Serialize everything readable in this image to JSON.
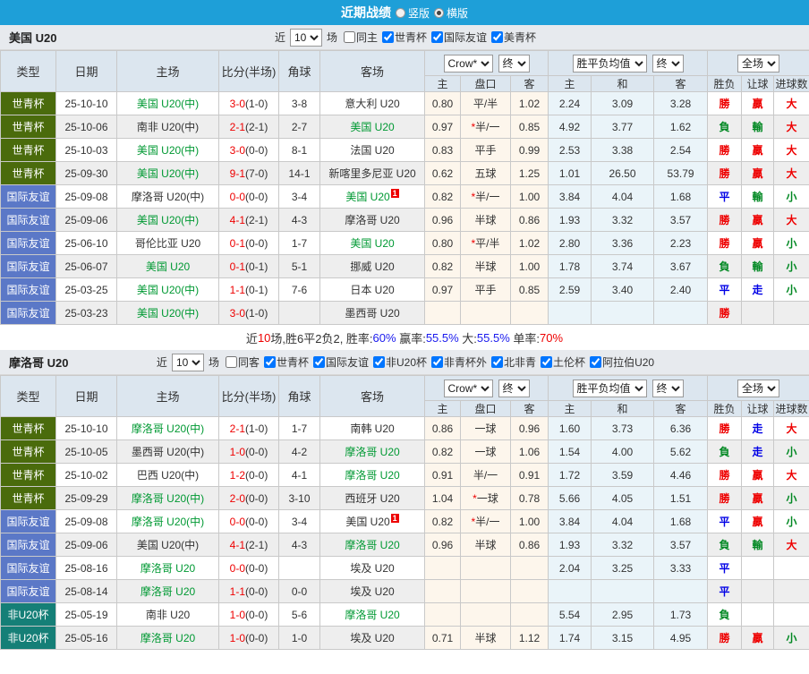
{
  "topbar": {
    "title": "近期战绩",
    "vertical_label": "竖版",
    "horizontal_label": "横版",
    "selected": "横版"
  },
  "filter": {
    "near": "近",
    "count": "10",
    "games": "场"
  },
  "table_header": {
    "type": "类型",
    "date": "日期",
    "home": "主场",
    "score": "比分(半场)",
    "corner": "角球",
    "away": "客场",
    "crow": "Crow*",
    "final": "终",
    "avg": "胜平负均值",
    "scope": "全场",
    "sub": [
      "主",
      "盘口",
      "客",
      "主",
      "和",
      "客",
      "胜负",
      "让球",
      "进球数"
    ]
  },
  "colors": {
    "type": {
      "世青杯": "#4a6b0c",
      "国际友谊": "#5b78c7",
      "非U20杯": "#157f77"
    },
    "focus_team": "#009933",
    "win": "#ee0000",
    "lose": "#008822",
    "draw": "#0000e6",
    "topbar": "#1e9fd8",
    "header_bg": "#dce6ef",
    "crow_bg": "#fdf6ec",
    "avg_bg": "#eaf4f9"
  },
  "sections": [
    {
      "team": "美国 U20",
      "same_label": "同主",
      "same_checked": false,
      "competitions": [
        "世青杯",
        "国际友谊",
        "美青杯"
      ],
      "rows": [
        {
          "type": "世青杯",
          "date": "25-10-10",
          "home": "美国 U20(中)",
          "home_focus": true,
          "ft": "3-0",
          "ht": "(1-0)",
          "corner": "3-8",
          "away": "意大利 U20",
          "away_focus": false,
          "badge": "",
          "ch": "0.80",
          "hs": false,
          "hc": "平/半",
          "ca": "1.02",
          "ah": "2.24",
          "ad": "3.09",
          "aa": "3.28",
          "r1": "勝",
          "c1": "w",
          "r2": "贏",
          "c2": "w",
          "r3": "大",
          "c3": "w"
        },
        {
          "type": "世青杯",
          "date": "25-10-06",
          "home": "南非 U20(中)",
          "home_focus": false,
          "ft": "2-1",
          "ht": "(2-1)",
          "corner": "2-7",
          "away": "美国 U20",
          "away_focus": true,
          "badge": "",
          "ch": "0.97",
          "hs": true,
          "hc": "半/一",
          "ca": "0.85",
          "ah": "4.92",
          "ad": "3.77",
          "aa": "1.62",
          "r1": "負",
          "c1": "l",
          "r2": "輸",
          "c2": "l",
          "r3": "大",
          "c3": "w"
        },
        {
          "type": "世青杯",
          "date": "25-10-03",
          "home": "美国 U20(中)",
          "home_focus": true,
          "ft": "3-0",
          "ht": "(0-0)",
          "corner": "8-1",
          "away": "法国 U20",
          "away_focus": false,
          "badge": "",
          "ch": "0.83",
          "hs": false,
          "hc": "平手",
          "ca": "0.99",
          "ah": "2.53",
          "ad": "3.38",
          "aa": "2.54",
          "r1": "勝",
          "c1": "w",
          "r2": "贏",
          "c2": "w",
          "r3": "大",
          "c3": "w"
        },
        {
          "type": "世青杯",
          "date": "25-09-30",
          "home": "美国 U20(中)",
          "home_focus": true,
          "ft": "9-1",
          "ht": "(7-0)",
          "corner": "14-1",
          "away": "新喀里多尼亚 U20",
          "away_focus": false,
          "badge": "",
          "ch": "0.62",
          "hs": false,
          "hc": "五球",
          "ca": "1.25",
          "ah": "1.01",
          "ad": "26.50",
          "aa": "53.79",
          "r1": "勝",
          "c1": "w",
          "r2": "贏",
          "c2": "w",
          "r3": "大",
          "c3": "w"
        },
        {
          "type": "国际友谊",
          "date": "25-09-08",
          "home": "摩洛哥 U20(中)",
          "home_focus": false,
          "ft": "0-0",
          "ht": "(0-0)",
          "corner": "3-4",
          "away": "美国 U20",
          "away_focus": true,
          "badge": "1",
          "ch": "0.82",
          "hs": true,
          "hc": "半/一",
          "ca": "1.00",
          "ah": "3.84",
          "ad": "4.04",
          "aa": "1.68",
          "r1": "平",
          "c1": "d",
          "r2": "輸",
          "c2": "l",
          "r3": "小",
          "c3": "l"
        },
        {
          "type": "国际友谊",
          "date": "25-09-06",
          "home": "美国 U20(中)",
          "home_focus": true,
          "ft": "4-1",
          "ht": "(2-1)",
          "corner": "4-3",
          "away": "摩洛哥 U20",
          "away_focus": false,
          "badge": "",
          "ch": "0.96",
          "hs": false,
          "hc": "半球",
          "ca": "0.86",
          "ah": "1.93",
          "ad": "3.32",
          "aa": "3.57",
          "r1": "勝",
          "c1": "w",
          "r2": "贏",
          "c2": "w",
          "r3": "大",
          "c3": "w"
        },
        {
          "type": "国际友谊",
          "date": "25-06-10",
          "home": "哥伦比亚 U20",
          "home_focus": false,
          "ft": "0-1",
          "ht": "(0-0)",
          "corner": "1-7",
          "away": "美国 U20",
          "away_focus": true,
          "badge": "",
          "ch": "0.80",
          "hs": true,
          "hc": "平/半",
          "ca": "1.02",
          "ah": "2.80",
          "ad": "3.36",
          "aa": "2.23",
          "r1": "勝",
          "c1": "w",
          "r2": "贏",
          "c2": "w",
          "r3": "小",
          "c3": "l"
        },
        {
          "type": "国际友谊",
          "date": "25-06-07",
          "home": "美国 U20",
          "home_focus": true,
          "ft": "0-1",
          "ht": "(0-1)",
          "corner": "5-1",
          "away": "挪威 U20",
          "away_focus": false,
          "badge": "",
          "ch": "0.82",
          "hs": false,
          "hc": "半球",
          "ca": "1.00",
          "ah": "1.78",
          "ad": "3.74",
          "aa": "3.67",
          "r1": "負",
          "c1": "l",
          "r2": "輸",
          "c2": "l",
          "r3": "小",
          "c3": "l"
        },
        {
          "type": "国际友谊",
          "date": "25-03-25",
          "home": "美国 U20(中)",
          "home_focus": true,
          "ft": "1-1",
          "ht": "(0-1)",
          "corner": "7-6",
          "away": "日本 U20",
          "away_focus": false,
          "badge": "",
          "ch": "0.97",
          "hs": false,
          "hc": "平手",
          "ca": "0.85",
          "ah": "2.59",
          "ad": "3.40",
          "aa": "2.40",
          "r1": "平",
          "c1": "d",
          "r2": "走",
          "c2": "d",
          "r3": "小",
          "c3": "l"
        },
        {
          "type": "国际友谊",
          "date": "25-03-23",
          "home": "美国 U20(中)",
          "home_focus": true,
          "ft": "3-0",
          "ht": "(1-0)",
          "corner": "",
          "away": "墨西哥 U20",
          "away_focus": false,
          "badge": "",
          "ch": "",
          "hs": false,
          "hc": "",
          "ca": "",
          "ah": "",
          "ad": "",
          "aa": "",
          "r1": "勝",
          "c1": "w",
          "r2": "",
          "c2": "k",
          "r3": "",
          "c3": "k"
        }
      ],
      "summary": [
        {
          "t": "近",
          "c": "k"
        },
        {
          "t": "10",
          "c": "w"
        },
        {
          "t": "场,胜6平2负2, 胜率:",
          "c": "k"
        },
        {
          "t": "60%",
          "c": "d"
        },
        {
          "t": " 赢率:",
          "c": "k"
        },
        {
          "t": "55.5%",
          "c": "d"
        },
        {
          "t": " 大:",
          "c": "k"
        },
        {
          "t": "55.5%",
          "c": "d"
        },
        {
          "t": " 单率:",
          "c": "k"
        },
        {
          "t": "70%",
          "c": "w"
        }
      ]
    },
    {
      "team": "摩洛哥 U20",
      "same_label": "同客",
      "same_checked": false,
      "competitions": [
        "世青杯",
        "国际友谊",
        "非U20杯",
        "非青杯外",
        "北非青",
        "土伦杯",
        "阿拉伯U20"
      ],
      "rows": [
        {
          "type": "世青杯",
          "date": "25-10-10",
          "home": "摩洛哥 U20(中)",
          "home_focus": true,
          "ft": "2-1",
          "ht": "(1-0)",
          "corner": "1-7",
          "away": "南韩 U20",
          "away_focus": false,
          "badge": "",
          "ch": "0.86",
          "hs": false,
          "hc": "一球",
          "ca": "0.96",
          "ah": "1.60",
          "ad": "3.73",
          "aa": "6.36",
          "r1": "勝",
          "c1": "w",
          "r2": "走",
          "c2": "d",
          "r3": "大",
          "c3": "w"
        },
        {
          "type": "世青杯",
          "date": "25-10-05",
          "home": "墨西哥 U20(中)",
          "home_focus": false,
          "ft": "1-0",
          "ht": "(0-0)",
          "corner": "4-2",
          "away": "摩洛哥 U20",
          "away_focus": true,
          "badge": "",
          "ch": "0.82",
          "hs": false,
          "hc": "一球",
          "ca": "1.06",
          "ah": "1.54",
          "ad": "4.00",
          "aa": "5.62",
          "r1": "負",
          "c1": "l",
          "r2": "走",
          "c2": "d",
          "r3": "小",
          "c3": "l"
        },
        {
          "type": "世青杯",
          "date": "25-10-02",
          "home": "巴西 U20(中)",
          "home_focus": false,
          "ft": "1-2",
          "ht": "(0-0)",
          "corner": "4-1",
          "away": "摩洛哥 U20",
          "away_focus": true,
          "badge": "",
          "ch": "0.91",
          "hs": false,
          "hc": "半/一",
          "ca": "0.91",
          "ah": "1.72",
          "ad": "3.59",
          "aa": "4.46",
          "r1": "勝",
          "c1": "w",
          "r2": "贏",
          "c2": "w",
          "r3": "大",
          "c3": "w"
        },
        {
          "type": "世青杯",
          "date": "25-09-29",
          "home": "摩洛哥 U20(中)",
          "home_focus": true,
          "ft": "2-0",
          "ht": "(0-0)",
          "corner": "3-10",
          "away": "西班牙 U20",
          "away_focus": false,
          "badge": "",
          "ch": "1.04",
          "hs": true,
          "hc": "一球",
          "ca": "0.78",
          "ah": "5.66",
          "ad": "4.05",
          "aa": "1.51",
          "r1": "勝",
          "c1": "w",
          "r2": "贏",
          "c2": "w",
          "r3": "小",
          "c3": "l"
        },
        {
          "type": "国际友谊",
          "date": "25-09-08",
          "home": "摩洛哥 U20(中)",
          "home_focus": true,
          "ft": "0-0",
          "ht": "(0-0)",
          "corner": "3-4",
          "away": "美国 U20",
          "away_focus": false,
          "badge": "1",
          "ch": "0.82",
          "hs": true,
          "hc": "半/一",
          "ca": "1.00",
          "ah": "3.84",
          "ad": "4.04",
          "aa": "1.68",
          "r1": "平",
          "c1": "d",
          "r2": "贏",
          "c2": "w",
          "r3": "小",
          "c3": "l"
        },
        {
          "type": "国际友谊",
          "date": "25-09-06",
          "home": "美国 U20(中)",
          "home_focus": false,
          "ft": "4-1",
          "ht": "(2-1)",
          "corner": "4-3",
          "away": "摩洛哥 U20",
          "away_focus": true,
          "badge": "",
          "ch": "0.96",
          "hs": false,
          "hc": "半球",
          "ca": "0.86",
          "ah": "1.93",
          "ad": "3.32",
          "aa": "3.57",
          "r1": "負",
          "c1": "l",
          "r2": "輸",
          "c2": "l",
          "r3": "大",
          "c3": "w"
        },
        {
          "type": "国际友谊",
          "date": "25-08-16",
          "home": "摩洛哥 U20",
          "home_focus": true,
          "ft": "0-0",
          "ht": "(0-0)",
          "corner": "",
          "away": "埃及 U20",
          "away_focus": false,
          "badge": "",
          "ch": "",
          "hs": false,
          "hc": "",
          "ca": "",
          "ah": "2.04",
          "ad": "3.25",
          "aa": "3.33",
          "r1": "平",
          "c1": "d",
          "r2": "",
          "c2": "k",
          "r3": "",
          "c3": "k"
        },
        {
          "type": "国际友谊",
          "date": "25-08-14",
          "home": "摩洛哥 U20",
          "home_focus": true,
          "ft": "1-1",
          "ht": "(0-0)",
          "corner": "0-0",
          "away": "埃及 U20",
          "away_focus": false,
          "badge": "",
          "ch": "",
          "hs": false,
          "hc": "",
          "ca": "",
          "ah": "",
          "ad": "",
          "aa": "",
          "r1": "平",
          "c1": "d",
          "r2": "",
          "c2": "k",
          "r3": "",
          "c3": "k"
        },
        {
          "type": "非U20杯",
          "date": "25-05-19",
          "home": "南非 U20",
          "home_focus": false,
          "ft": "1-0",
          "ht": "(0-0)",
          "corner": "5-6",
          "away": "摩洛哥 U20",
          "away_focus": true,
          "badge": "",
          "ch": "",
          "hs": false,
          "hc": "",
          "ca": "",
          "ah": "5.54",
          "ad": "2.95",
          "aa": "1.73",
          "r1": "負",
          "c1": "l",
          "r2": "",
          "c2": "k",
          "r3": "",
          "c3": "k"
        },
        {
          "type": "非U20杯",
          "date": "25-05-16",
          "home": "摩洛哥 U20",
          "home_focus": true,
          "ft": "1-0",
          "ht": "(0-0)",
          "corner": "1-0",
          "away": "埃及 U20",
          "away_focus": false,
          "badge": "",
          "ch": "0.71",
          "hs": false,
          "hc": "半球",
          "ca": "1.12",
          "ah": "1.74",
          "ad": "3.15",
          "aa": "4.95",
          "r1": "勝",
          "c1": "w",
          "r2": "贏",
          "c2": "w",
          "r3": "小",
          "c3": "l"
        }
      ],
      "summary": null
    }
  ]
}
